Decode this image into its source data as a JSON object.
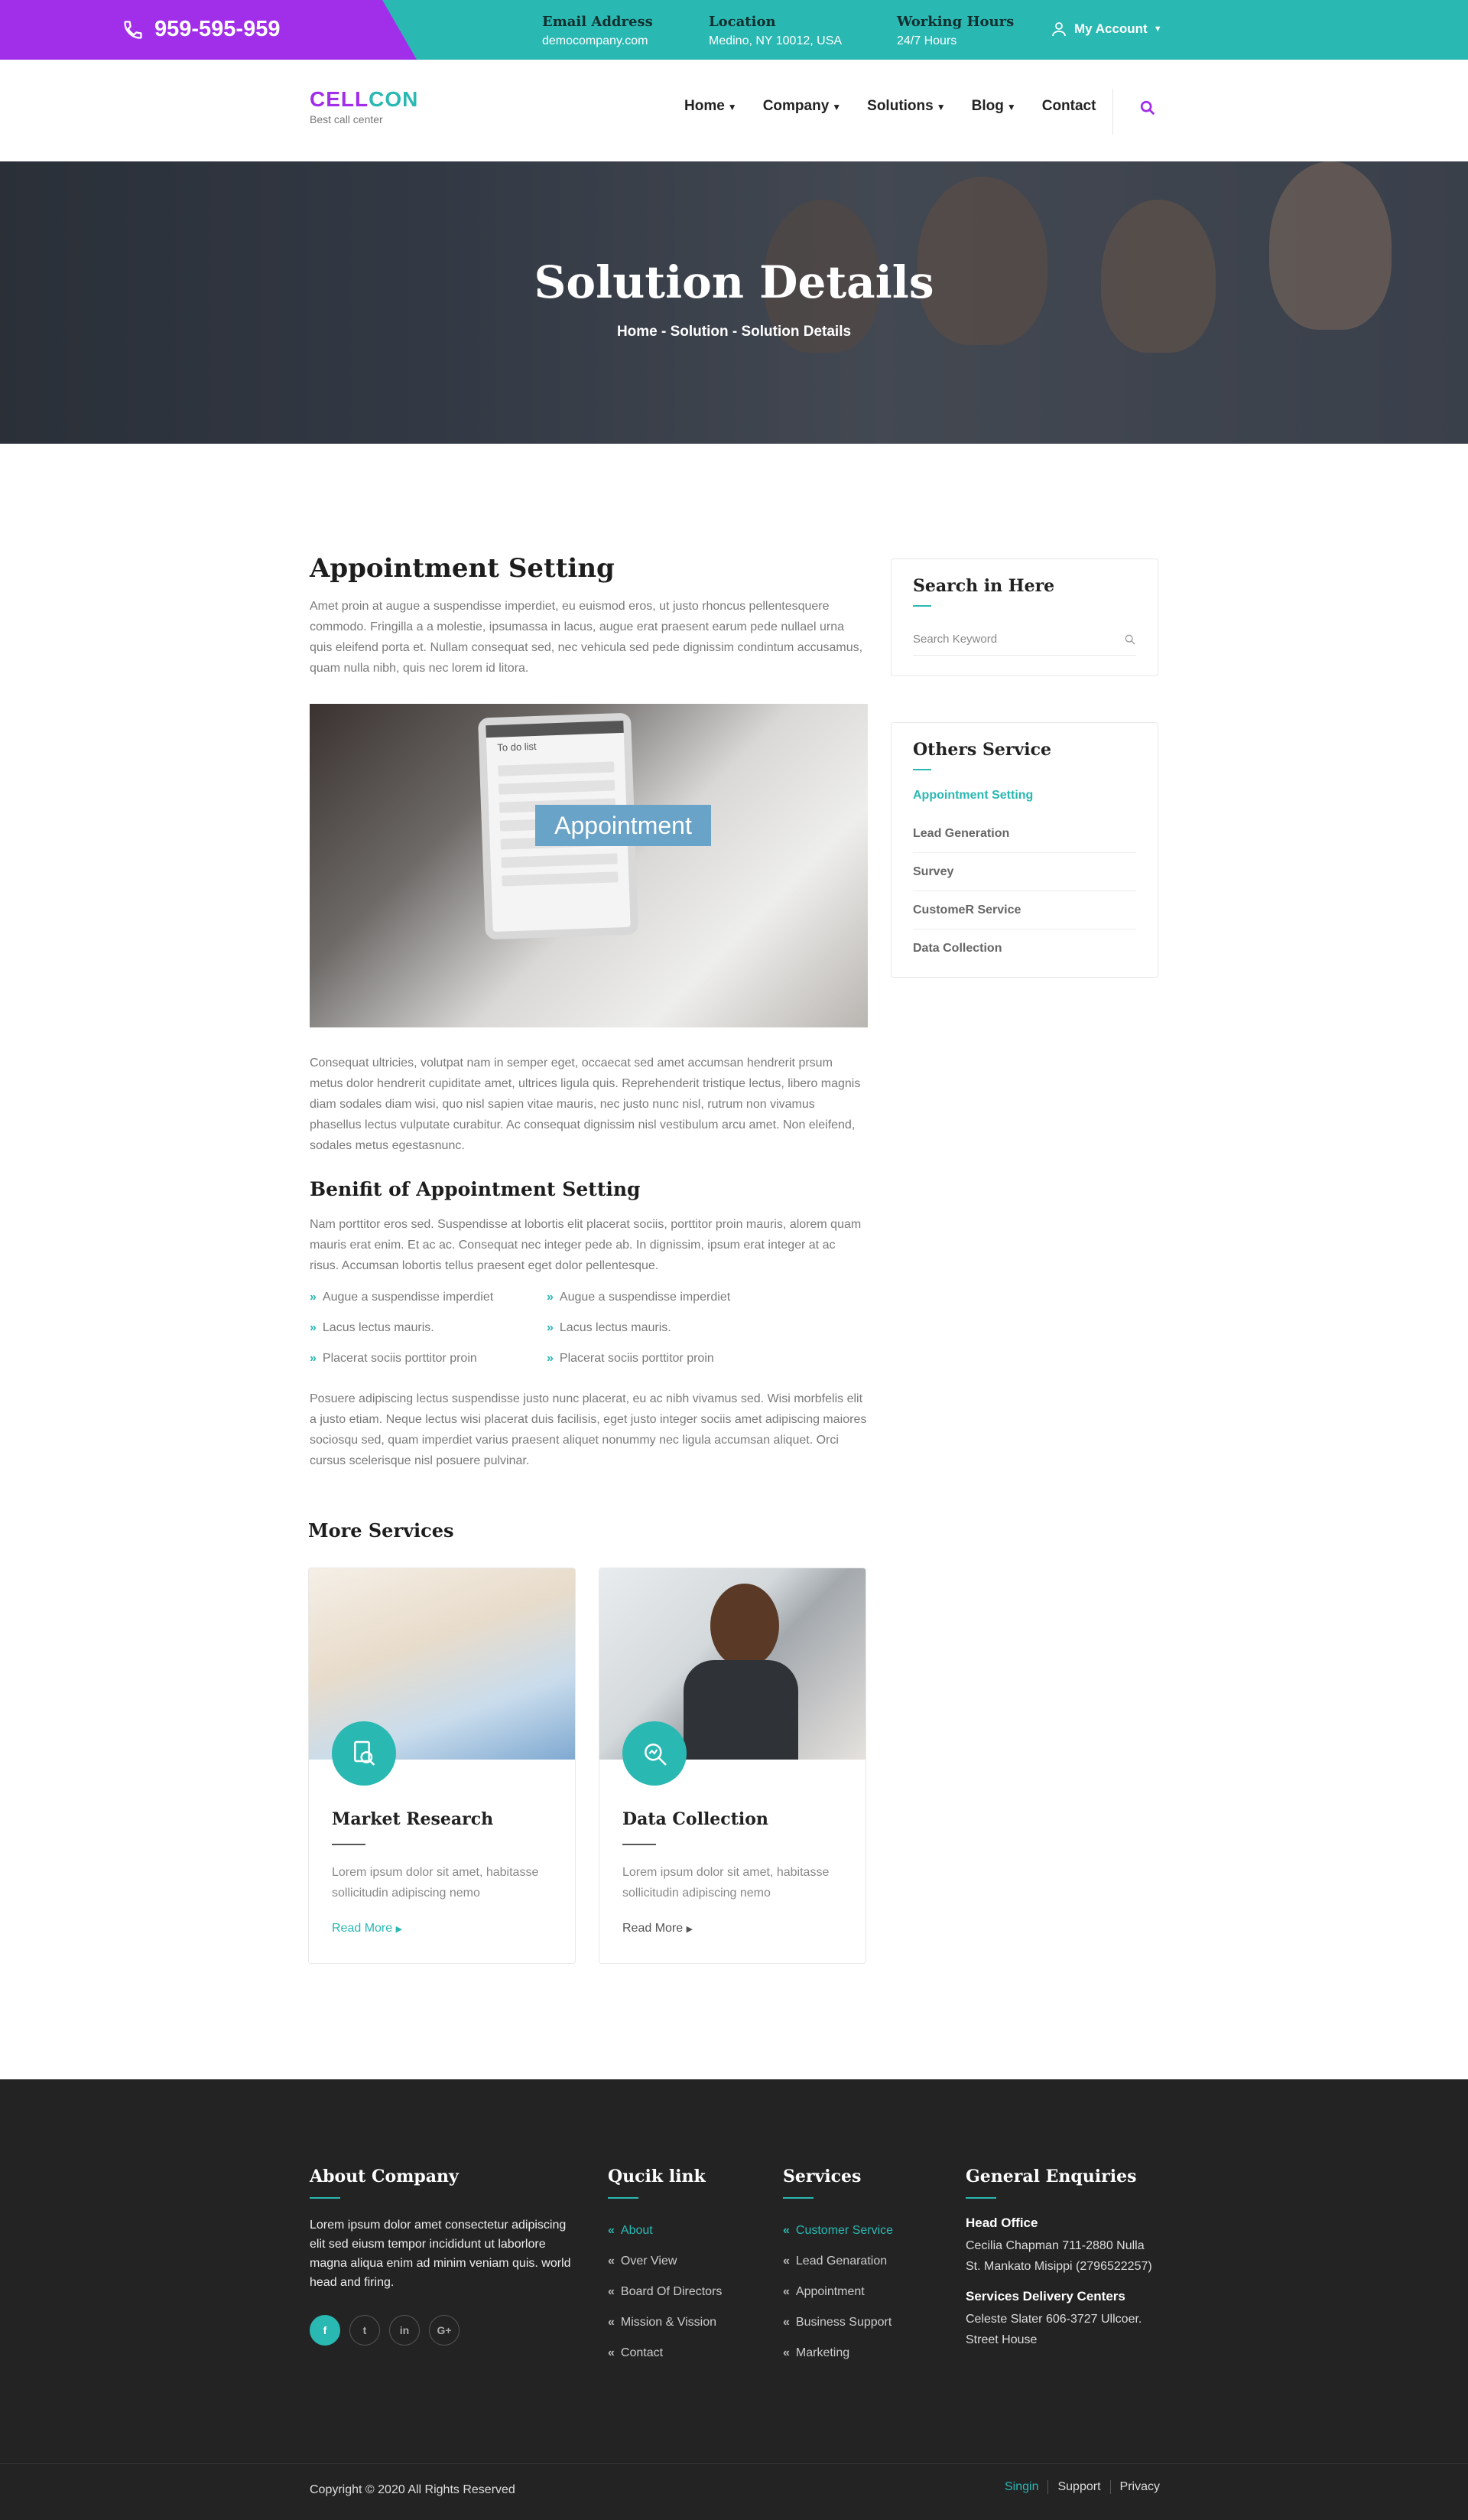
{
  "topbar": {
    "phone": "959-595-959",
    "email_label": "Email Address",
    "email": "democompany.com",
    "location_label": "Location",
    "location": "Medino, NY 10012, USA",
    "hours_label": "Working Hours",
    "hours": "24/7 Hours",
    "account": "My Account"
  },
  "logo": {
    "part1": "CELL",
    "part2": "CON",
    "tagline": "Best call center"
  },
  "menu": [
    "Home",
    "Company",
    "Solutions",
    "Blog",
    "Contact"
  ],
  "hero": {
    "title": "Solution Details",
    "breadcrumb": "Home - Solution  -  Solution Details"
  },
  "main": {
    "title": "Appointment Setting",
    "intro": "Amet proin at augue a suspendisse imperdiet, eu euismod eros, ut justo rhoncus pellentesquere commodo. Fringilla a a molestie, ipsumassa in lacus, augue erat praesent earum pede nullael urna quis eleifend porta et. Nullam consequat sed, nec vehicula sed pede dignissim condintum accusamus, quam nulla nibh, quis nec lorem id litora.",
    "image_text": "Appointment",
    "tablet_title": "To do list",
    "para2": "Consequat ultricies, volutpat nam in semper eget, occaecat sed amet accumsan hendrerit prsum metus dolor hendrerit cupiditate amet, ultrices ligula quis. Reprehenderit tristique lectus, libero magnis diam sodales diam wisi, quo nisl sapien vitae mauris, nec justo nunc nisl, rutrum non vivamus phasellus lectus vulputate curabitur. Ac consequat dignissim nisl vestibulum arcu amet. Non eleifend, sodales metus egestasnunc.",
    "benefit_title": "Benifit of Appointment Setting",
    "benefit_text": "Nam porttitor eros sed. Suspendisse at lobortis elit placerat sociis, porttitor proin mauris, alorem quam mauris erat enim. Et ac ac. Consequat nec integer pede ab. In dignissim, ipsum erat integer at ac risus. Accumsan lobortis tellus praesent eget dolor pellentesque.",
    "list": [
      "Augue a suspendisse imperdiet",
      "Augue a suspendisse imperdiet",
      "Lacus lectus mauris.",
      "Lacus lectus mauris.",
      "Placerat sociis porttitor proin",
      "Placerat sociis porttitor proin"
    ],
    "para3": "Posuere adipiscing lectus suspendisse justo nunc placerat, eu ac nibh vivamus sed. Wisi morbfelis elit a justo etiam. Neque lectus wisi placerat duis facilisis, eget justo integer sociis amet adipiscing maiores sociosqu sed, quam imperdiet varius praesent aliquet nonummy nec ligula accumsan aliquet. Orci cursus scelerisque nisl posuere pulvinar.",
    "more_title": "More Services"
  },
  "cards": [
    {
      "title": "Market Research",
      "text": "Lorem ipsum dolor sit amet, habitasse sollicitudin adipiscing nemo",
      "link": "Read More"
    },
    {
      "title": "Data Collection",
      "text": "Lorem ipsum dolor sit amet, habitasse sollicitudin adipiscing nemo",
      "link": "Read More"
    }
  ],
  "sidebar": {
    "search_title": "Search in Here",
    "search_placeholder": "Search Keyword",
    "others_title": "Others Service",
    "items": [
      "Appointment Setting",
      "Lead Generation",
      "Survey",
      "CustomeR Service",
      "Data Collection"
    ]
  },
  "footer": {
    "about_title": "About Company",
    "about_text": "Lorem ipsum dolor amet consectetur adipiscing elit sed eiusm tempor incididunt ut laborlore magna aliqua enim ad minim veniam quis. world head and firing.",
    "social": [
      "f",
      "t",
      "in",
      "G+"
    ],
    "quick_title": "Qucik link",
    "quick": [
      "About",
      "Over View",
      "Board Of Directors",
      "Mission & Vission",
      "Contact"
    ],
    "services_title": "Services",
    "services": [
      "Customer Service",
      "Lead Genaration",
      "Appointment",
      "Business Support",
      "Marketing"
    ],
    "enq_title": "General Enquiries",
    "head_office": "Head Office",
    "head_addr1": "Cecilia Chapman 711-2880 Nulla",
    "head_addr2": "St. Mankato Misippi (2796522257)",
    "centers": "Services Delivery Centers",
    "center_addr1": "Celeste Slater 606-3727 Ullcoer.",
    "center_addr2": "Street House",
    "copyright": "Copyright © 2020 All Rights Reserved",
    "links": [
      "Singin",
      "Support",
      "Privacy"
    ]
  },
  "colors": {
    "teal": "#2ab8b3",
    "purple": "#a12ee8",
    "footer": "#232323"
  }
}
